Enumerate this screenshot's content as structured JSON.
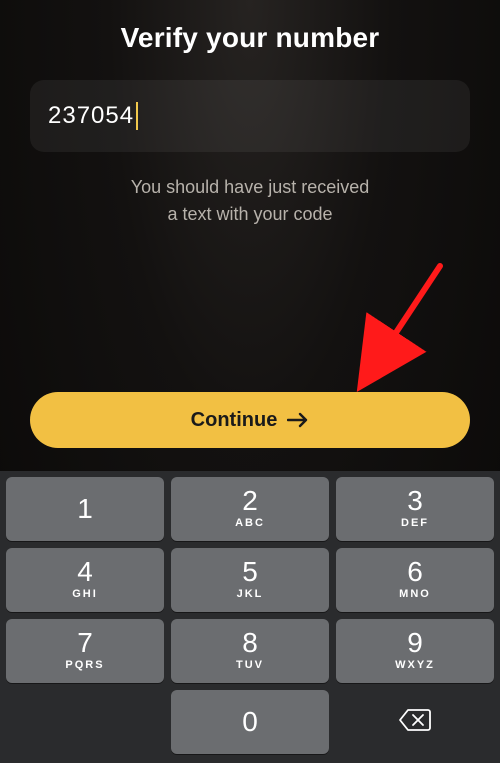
{
  "header": {
    "title": "Verify your number"
  },
  "code_input": {
    "value": "237054"
  },
  "helper": {
    "line1": "You should have just received",
    "line2": "a text with your code"
  },
  "continue": {
    "label": "Continue"
  },
  "keypad": {
    "keys": [
      {
        "digit": "1",
        "letters": ""
      },
      {
        "digit": "2",
        "letters": "ABC"
      },
      {
        "digit": "3",
        "letters": "DEF"
      },
      {
        "digit": "4",
        "letters": "GHI"
      },
      {
        "digit": "5",
        "letters": "JKL"
      },
      {
        "digit": "6",
        "letters": "MNO"
      },
      {
        "digit": "7",
        "letters": "PQRS"
      },
      {
        "digit": "8",
        "letters": "TUV"
      },
      {
        "digit": "9",
        "letters": "WXYZ"
      }
    ],
    "zero": {
      "digit": "0",
      "letters": ""
    }
  },
  "annotation": {
    "arrow_color": "#ff1a1a"
  }
}
